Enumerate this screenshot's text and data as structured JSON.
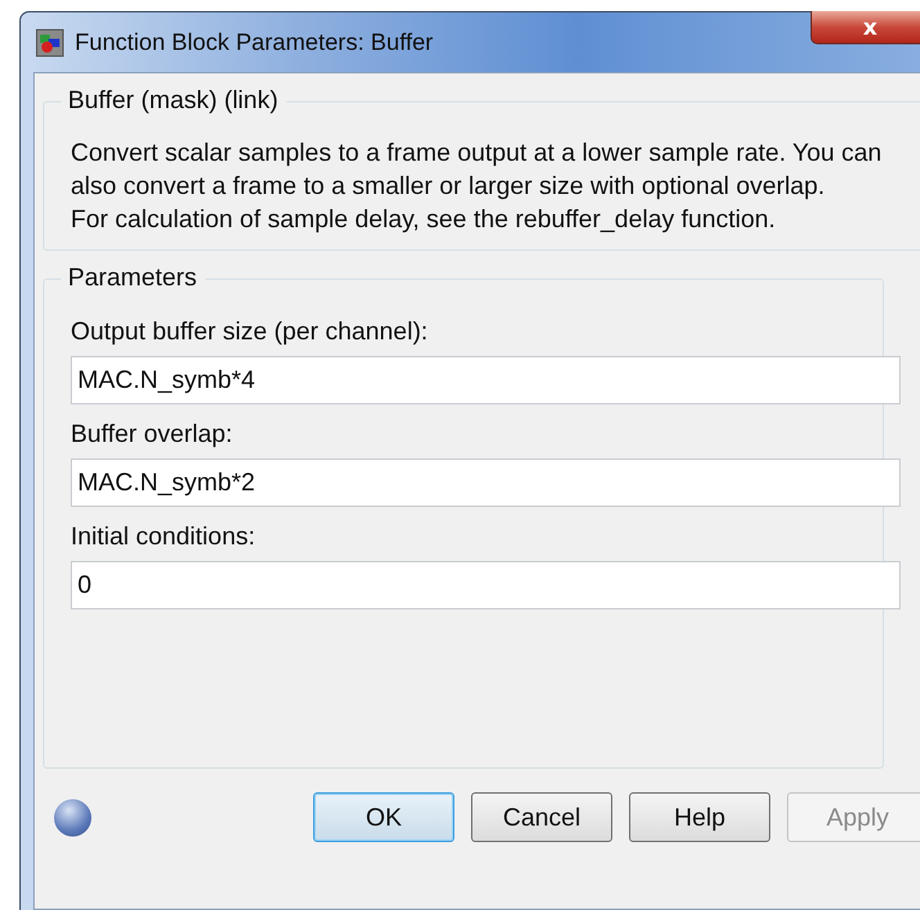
{
  "window": {
    "title": "Function Block Parameters: Buffer",
    "close": "x"
  },
  "description": {
    "title": "Buffer (mask) (link)",
    "paragraphs": [
      "Convert scalar samples to a frame output at a lower sample rate. You can also convert a frame to a smaller or larger size with optional overlap.",
      "For calculation of sample delay, see the rebuffer_delay function."
    ]
  },
  "parameters": {
    "title": "Parameters",
    "fields": [
      {
        "label": "Output buffer size (per channel):",
        "value": "MAC.N_symb*4"
      },
      {
        "label": "Buffer overlap:",
        "value": "MAC.N_symb*2"
      },
      {
        "label": "Initial conditions:",
        "value": "0"
      }
    ]
  },
  "buttons": [
    {
      "label": "OK",
      "default": true,
      "disabled": false
    },
    {
      "label": "Cancel",
      "default": false,
      "disabled": false
    },
    {
      "label": "Help",
      "default": false,
      "disabled": false
    },
    {
      "label": "Apply",
      "default": false,
      "disabled": true
    }
  ]
}
